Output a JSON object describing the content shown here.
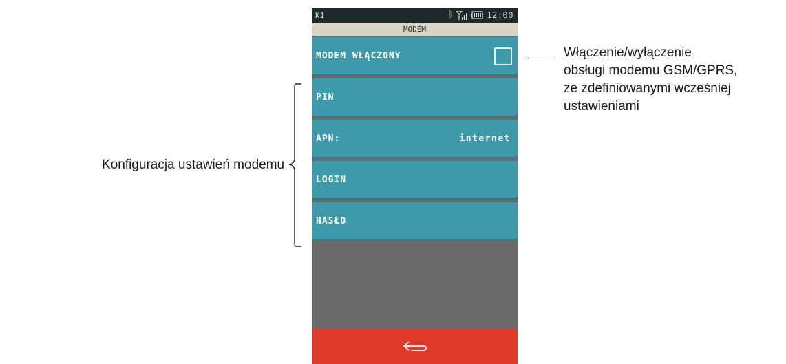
{
  "status_bar": {
    "station": "K1",
    "time": "12:00",
    "icons": [
      "bluetooth-icon",
      "signal-icon",
      "battery-icon"
    ]
  },
  "screen_title": "MODEM",
  "menu": [
    {
      "label": "MODEM WŁĄCZONY",
      "control": "checkbox",
      "checked": false
    },
    {
      "label": "PIN",
      "value": ""
    },
    {
      "label": "APN:",
      "value": "internet"
    },
    {
      "label": "LOGIN",
      "value": ""
    },
    {
      "label": "HASŁO",
      "value": ""
    }
  ],
  "bottom_bar": {
    "icon": "back-arrow-icon"
  },
  "annotations": {
    "right_line1": "Włączenie/wyłączenie",
    "right_line2": "obsługi modemu GSM/GPRS,",
    "right_line3": "ze zdefiniowanymi wcześniej",
    "right_line4": "ustawieniami",
    "left": "Konfiguracja ustawień modemu"
  },
  "colors": {
    "menu_item": "#3d9aab",
    "background": "#6b6a6a",
    "bottom_bar": "#e03a2a",
    "title_bar": "#d9d3c4",
    "status_bar": "#1d2a2b",
    "bluetooth": "#f0c020"
  }
}
